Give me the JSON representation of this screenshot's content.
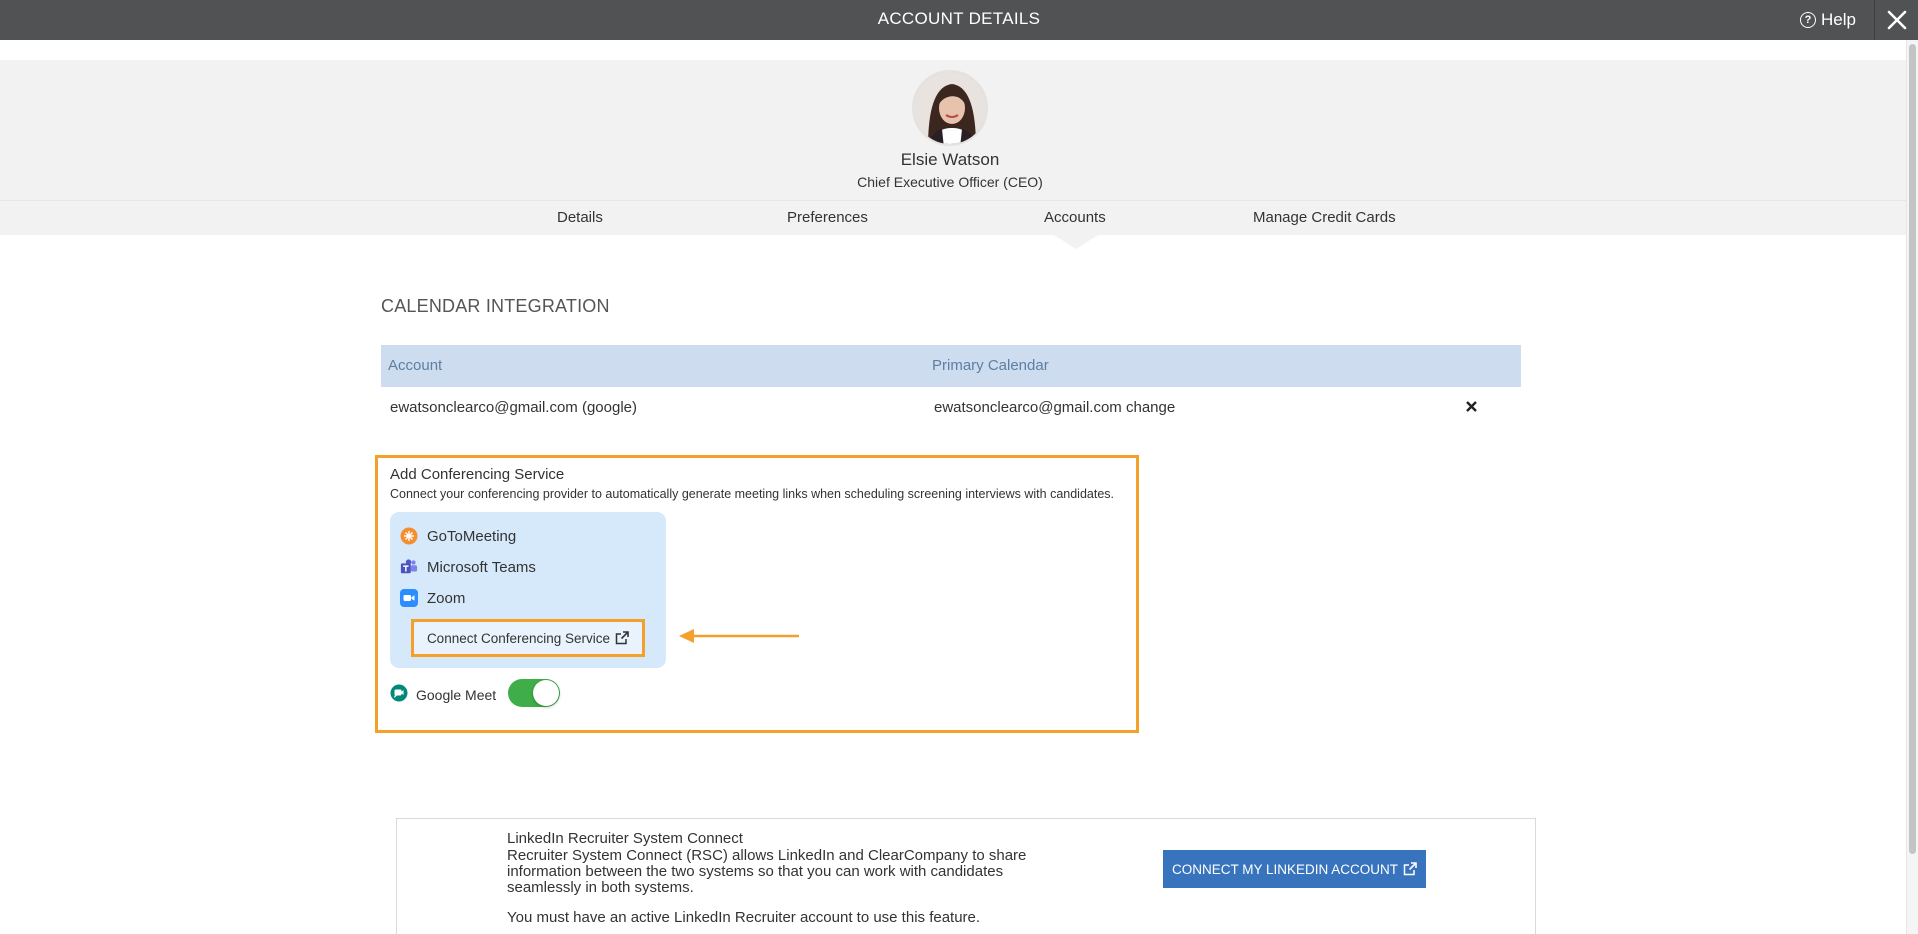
{
  "header": {
    "title": "ACCOUNT DETAILS",
    "help_label": "Help",
    "close_icon": "close-icon"
  },
  "profile": {
    "name": "Elsie Watson",
    "title": "Chief Executive Officer (CEO)"
  },
  "tabs": [
    {
      "label": "Details"
    },
    {
      "label": "Preferences"
    },
    {
      "label": "Accounts",
      "active": true
    },
    {
      "label": "Manage Credit Cards"
    }
  ],
  "calendar": {
    "section_title": "CALENDAR INTEGRATION",
    "columns": [
      "Account",
      "Primary Calendar"
    ],
    "rows": [
      {
        "account": "ewatsonclearco@gmail.com (google)",
        "primary_calendar": "ewatsonclearco@gmail.com",
        "change_label": "change"
      }
    ]
  },
  "conferencing": {
    "title": "Add Conferencing Service",
    "description": "Connect your conferencing provider to automatically generate meeting links when scheduling screening interviews with candidates.",
    "providers": [
      {
        "name": "GoToMeeting",
        "icon": "gotomeeting-icon"
      },
      {
        "name": "Microsoft Teams",
        "icon": "teams-icon"
      },
      {
        "name": "Zoom",
        "icon": "zoom-icon"
      }
    ],
    "connect_label": "Connect Conferencing Service",
    "google_meet_label": "Google Meet",
    "google_meet_enabled": true,
    "highlight_color": "#f5a02a"
  },
  "linkedin": {
    "title": "LinkedIn Recruiter System Connect",
    "description": "Recruiter System Connect (RSC) allows LinkedIn and ClearCompany to share information between the two systems so that you can work with candidates seamlessly in both systems.",
    "note": "You must have an active LinkedIn Recruiter account to use this feature.",
    "button_label": "CONNECT MY LINKEDIN ACCOUNT"
  },
  "colors": {
    "topbar": "#515254",
    "table_header": "#cddcee",
    "primary_button": "#3873bd",
    "toggle_on": "#3fae49"
  }
}
